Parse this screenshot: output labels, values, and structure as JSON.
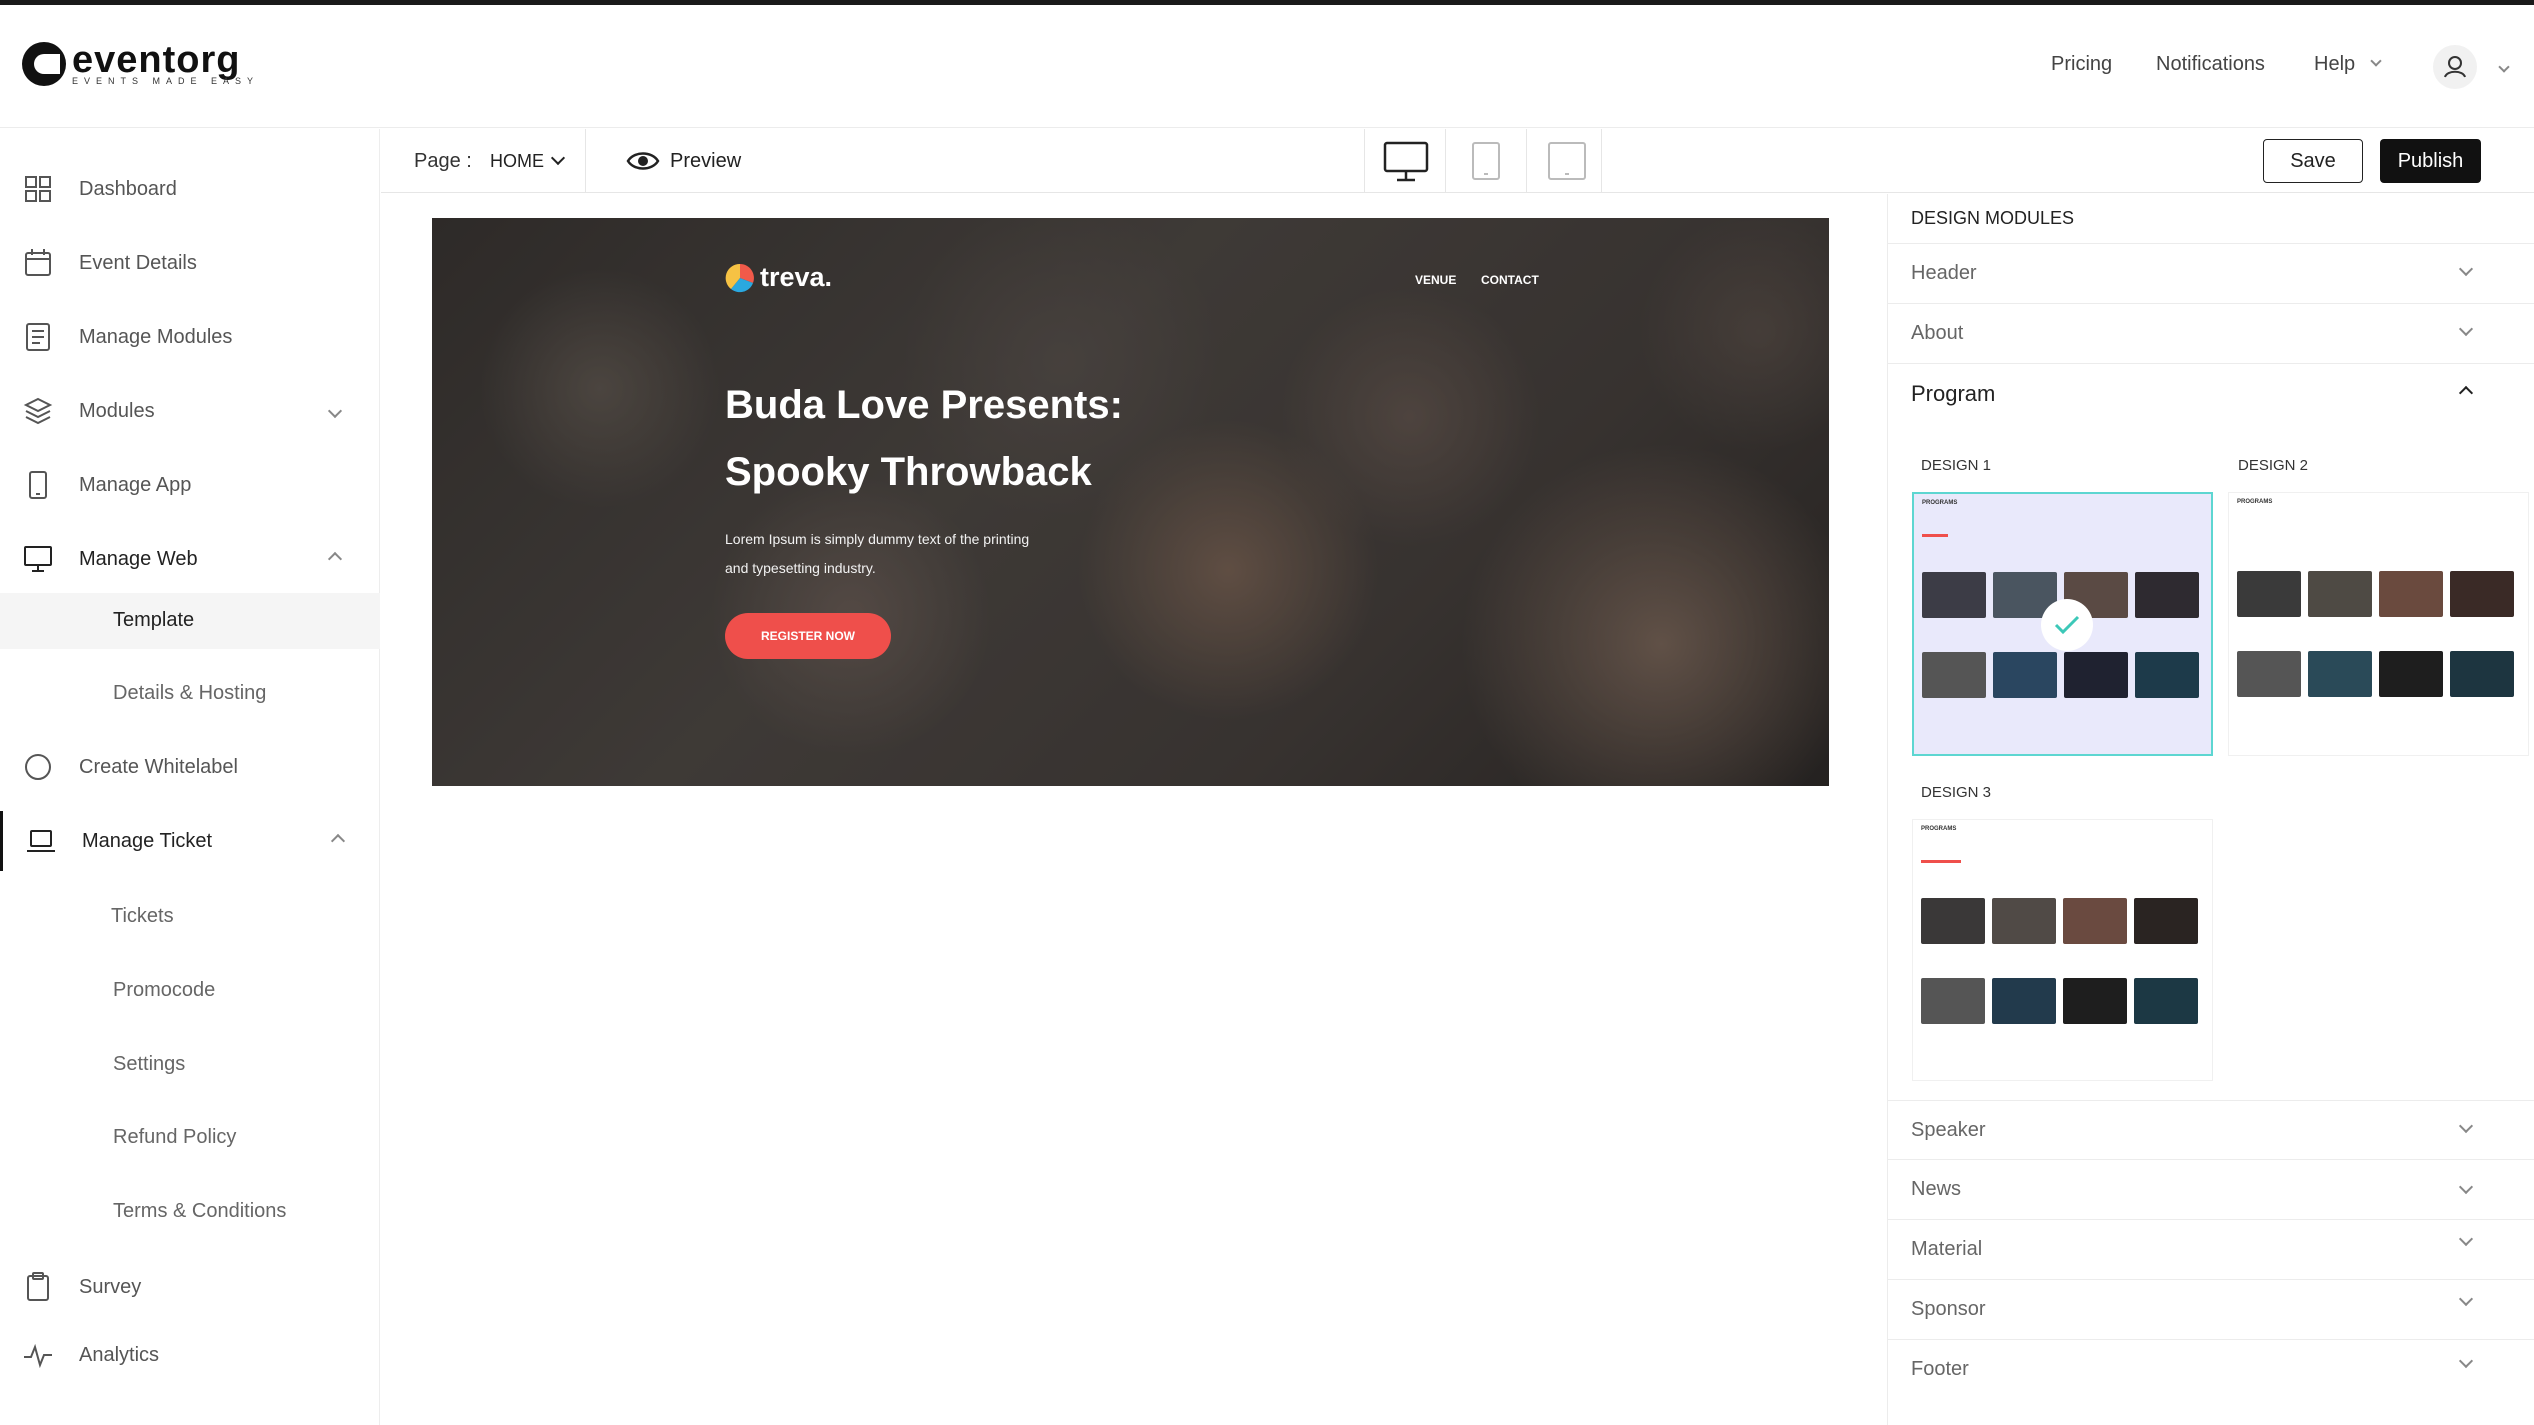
{
  "brand": {
    "name": "eventorg",
    "tagline": "EVENTS MADE EASY"
  },
  "topnav": {
    "pricing": "Pricing",
    "notifications": "Notifications",
    "help": "Help"
  },
  "sidebar": {
    "items": [
      {
        "label": "Dashboard",
        "icon": "grid-icon"
      },
      {
        "label": "Event Details",
        "icon": "calendar-icon"
      },
      {
        "label": "Manage Modules",
        "icon": "document-icon"
      },
      {
        "label": "Modules",
        "icon": "layers-icon"
      },
      {
        "label": "Manage App",
        "icon": "mobile-icon"
      },
      {
        "label": "Manage Web",
        "icon": "monitor-icon"
      },
      {
        "label": "Create Whitelabel",
        "icon": "circle-icon"
      },
      {
        "label": "Manage Ticket",
        "icon": "laptop-icon"
      },
      {
        "label": "Survey",
        "icon": "clipboard-icon"
      },
      {
        "label": "Analytics",
        "icon": "pulse-icon"
      }
    ],
    "web_sub": [
      "Template",
      "Details  & Hosting"
    ],
    "ticket_sub": [
      "Tickets",
      "Promocode",
      "Settings",
      "Refund Policy",
      "Terms  & Conditions"
    ]
  },
  "toolbar": {
    "page_label": "Page :",
    "page_value": "HOME",
    "preview": "Preview",
    "save": "Save",
    "publish": "Publish"
  },
  "hero": {
    "logo": "treva.",
    "nav": [
      "VENUE",
      "CONTACT"
    ],
    "title_line1": "Buda Love Presents:",
    "title_line2": "Spooky Throwback",
    "desc_line1": "Lorem Ipsum is simply dummy text of the printing",
    "desc_line2": "and typesetting industry.",
    "cta": "REGISTER NOW"
  },
  "panel": {
    "title": "DESIGN MODULES",
    "modules": [
      "Header",
      "About",
      "Program",
      "Speaker",
      "News",
      "Material",
      "Sponsor",
      "Footer"
    ],
    "designs": [
      "DESIGN 1",
      "DESIGN 2",
      "DESIGN 3"
    ],
    "thumb_heading": "PROGRAMS"
  },
  "colors": {
    "accent_red": "#ef4f4b",
    "selected_border": "#5dd6d1",
    "selected_bg": "#e9e9fb",
    "dark_button": "#111111"
  }
}
